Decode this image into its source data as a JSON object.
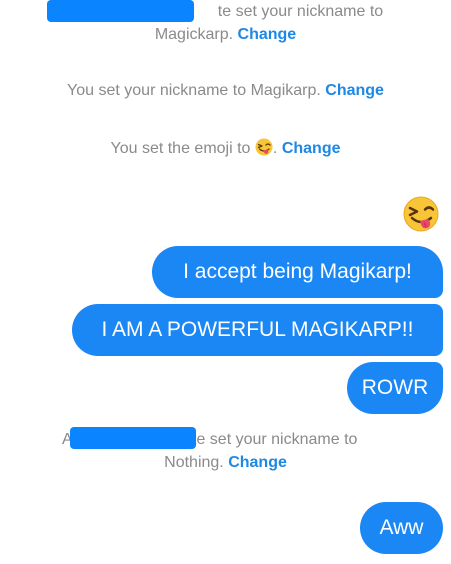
{
  "system_messages": {
    "nickname_top": {
      "text_line1": "te set your nickname to",
      "text_line2": "Magickarp.",
      "link": "Change"
    },
    "nickname_self": {
      "text": "You set your nickname to Magikarp.",
      "link": "Change"
    },
    "emoji_set": {
      "text_before": "You set the emoji to",
      "text_after": ".",
      "link": "Change",
      "emoji_icon": "winking-tongue-face-icon"
    },
    "nickname_bottom": {
      "prefix": "A",
      "text_line1": "te set your nickname to",
      "text_line2": "Nothing.",
      "link": "Change"
    }
  },
  "messages": [
    {
      "text": "I accept being Magikarp!"
    },
    {
      "text": "I AM A POWERFUL MAGIKARP!!"
    },
    {
      "text": "ROWR"
    },
    {
      "text": "Aww"
    }
  ],
  "sent_emoji": "winking-tongue-face-icon",
  "colors": {
    "bubble": "#1a87f5",
    "link": "#1e88e5",
    "system_text": "#8a8a8a",
    "redaction": "#0a84ff"
  }
}
